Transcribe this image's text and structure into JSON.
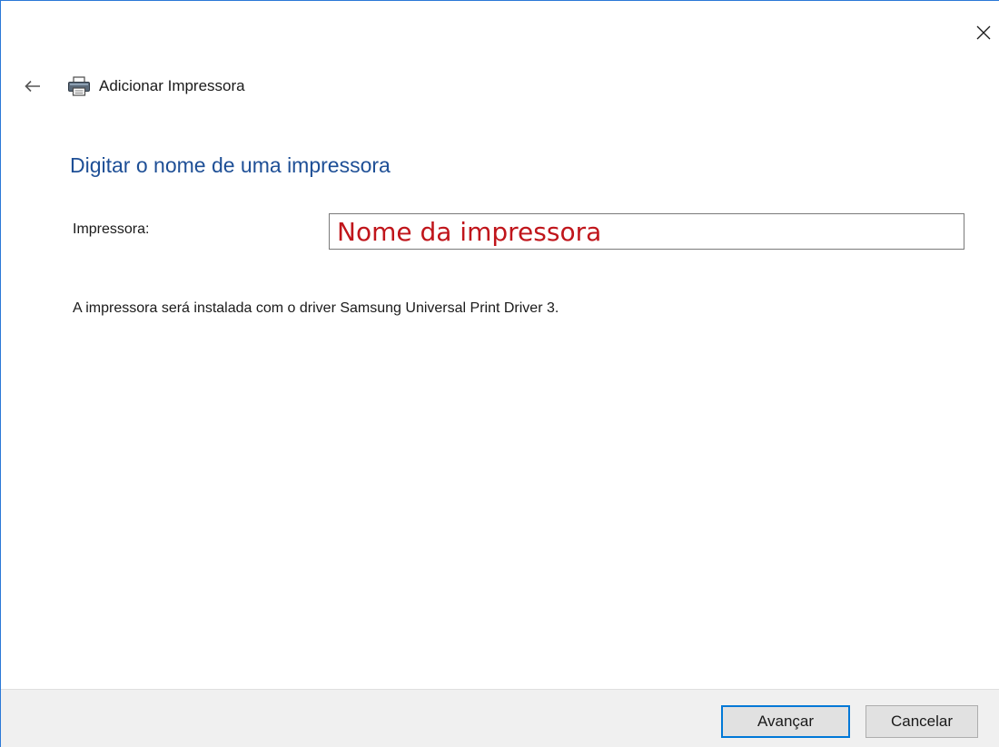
{
  "window": {
    "close_icon": "close-icon"
  },
  "header": {
    "back_icon": "back-arrow-icon",
    "printer_icon": "printer-icon",
    "title": "Adicionar Impressora"
  },
  "main": {
    "heading": "Digitar o nome de uma impressora",
    "printer_field": {
      "label": "Impressora:",
      "value": "",
      "placeholder": "Nome da impressora"
    },
    "info_text": "A impressora será instalada com o driver Samsung Universal Print Driver 3."
  },
  "footer": {
    "next_label": "Avançar",
    "cancel_label": "Cancelar"
  },
  "colors": {
    "heading": "#1e4f96",
    "placeholder": "#c0151b",
    "focus_accent": "#0078d7",
    "window_border": "#2b79d7"
  }
}
